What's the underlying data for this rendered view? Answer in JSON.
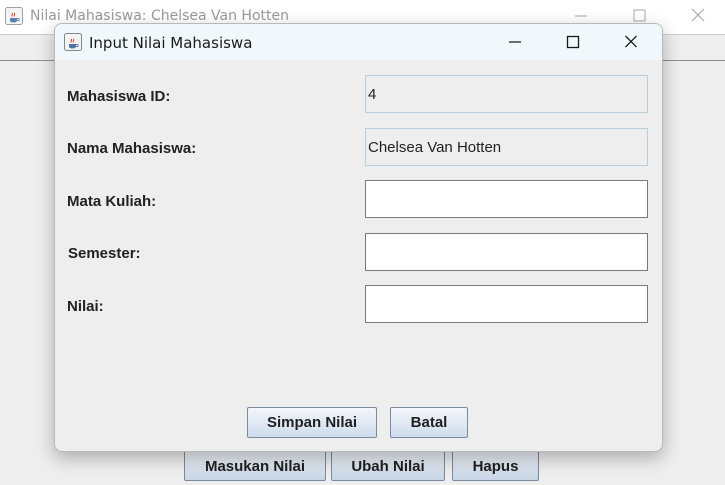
{
  "background_window": {
    "title": "Nilai Mahasiswa: Chelsea Van Hotten",
    "buttons": {
      "masukan": "Masukan Nilai",
      "ubah": "Ubah Nilai",
      "hapus": "Hapus"
    }
  },
  "dialog": {
    "title": "Input Nilai Mahasiswa",
    "fields": {
      "mahasiswa_id": {
        "label": "Mahasiswa ID:",
        "value": "4"
      },
      "nama": {
        "label": "Nama Mahasiswa:",
        "value": "Chelsea Van Hotten"
      },
      "mata_kuliah": {
        "label": "Mata Kuliah:",
        "value": ""
      },
      "semester": {
        "label": "Semester:",
        "value": ""
      },
      "nilai": {
        "label": "Nilai:",
        "value": ""
      }
    },
    "buttons": {
      "simpan": "Simpan Nilai",
      "batal": "Batal"
    }
  },
  "icons": {
    "app": "java-coffee-icon",
    "minimize": "minimize-icon",
    "maximize": "maximize-icon",
    "close": "close-icon"
  }
}
